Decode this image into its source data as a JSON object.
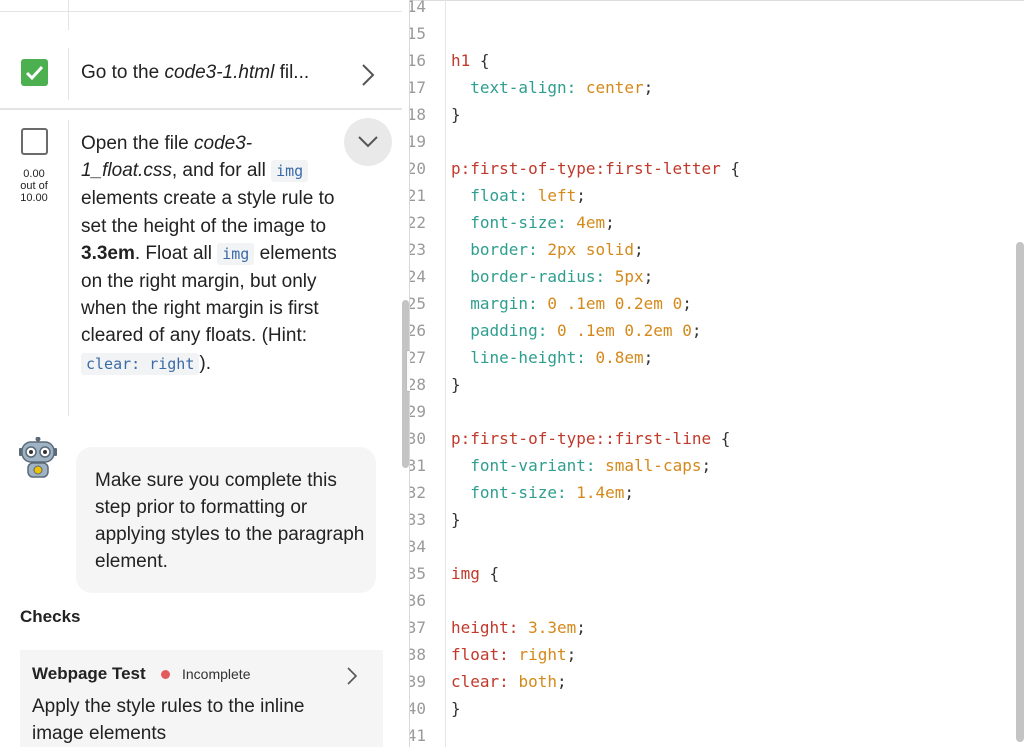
{
  "task1": {
    "status": "complete",
    "text_prefix": "Go to the ",
    "text_file": "code3-1.html",
    "text_suffix": " fil..."
  },
  "task2": {
    "status": "incomplete",
    "score": {
      "value": "0.00",
      "out_of_label": "out of",
      "total": "10.00"
    },
    "t1": "Open the file ",
    "t2": "code3-1_float.css",
    "t3": ", and for all ",
    "code1": "img",
    "t4": " elements create a style rule to set the height of the image to ",
    "t5": "3.3em",
    "t6": ". Float all ",
    "code2": "img",
    "t7": " elements on the right margin, but only when the right margin is first cleared of any floats. (Hint: ",
    "code3": "clear: right",
    "t8": ")."
  },
  "hint": {
    "avatar": "robot-icon",
    "text": "Make sure you complete this step prior to formatting or applying styles to the paragraph element."
  },
  "checks": {
    "title": "Checks",
    "items": [
      {
        "title": "Webpage Test",
        "status": "Incomplete",
        "status_color": "#e45a5a",
        "description": "Apply the style rules to the inline image elements"
      }
    ]
  },
  "editor": {
    "lines": [
      {
        "n": "14",
        "tokens": []
      },
      {
        "n": "15",
        "tokens": []
      },
      {
        "n": "16",
        "tokens": [
          {
            "t": "sel",
            "s": "h1"
          },
          {
            "t": "pun",
            "s": " {"
          }
        ]
      },
      {
        "n": "17",
        "tokens": [
          {
            "t": "pun",
            "s": "  "
          },
          {
            "t": "prop",
            "s": "text-align:"
          },
          {
            "t": "pun",
            "s": " "
          },
          {
            "t": "val",
            "s": "center"
          },
          {
            "t": "pun",
            "s": ";"
          }
        ]
      },
      {
        "n": "18",
        "tokens": [
          {
            "t": "pun",
            "s": "}"
          }
        ]
      },
      {
        "n": "19",
        "tokens": []
      },
      {
        "n": "20",
        "tokens": [
          {
            "t": "sel",
            "s": "p:first-of-type:first-letter"
          },
          {
            "t": "pun",
            "s": " {"
          }
        ]
      },
      {
        "n": "21",
        "tokens": [
          {
            "t": "pun",
            "s": "  "
          },
          {
            "t": "prop",
            "s": "float:"
          },
          {
            "t": "pun",
            "s": " "
          },
          {
            "t": "val",
            "s": "left"
          },
          {
            "t": "pun",
            "s": ";"
          }
        ]
      },
      {
        "n": "22",
        "tokens": [
          {
            "t": "pun",
            "s": "  "
          },
          {
            "t": "prop",
            "s": "font-size:"
          },
          {
            "t": "pun",
            "s": " "
          },
          {
            "t": "val",
            "s": "4em"
          },
          {
            "t": "pun",
            "s": ";"
          }
        ]
      },
      {
        "n": "23",
        "tokens": [
          {
            "t": "pun",
            "s": "  "
          },
          {
            "t": "prop",
            "s": "border:"
          },
          {
            "t": "pun",
            "s": " "
          },
          {
            "t": "val",
            "s": "2px solid"
          },
          {
            "t": "pun",
            "s": ";"
          }
        ]
      },
      {
        "n": "24",
        "tokens": [
          {
            "t": "pun",
            "s": "  "
          },
          {
            "t": "prop",
            "s": "border-radius:"
          },
          {
            "t": "pun",
            "s": " "
          },
          {
            "t": "val",
            "s": "5px"
          },
          {
            "t": "pun",
            "s": ";"
          }
        ]
      },
      {
        "n": "25",
        "tokens": [
          {
            "t": "pun",
            "s": "  "
          },
          {
            "t": "prop",
            "s": "margin:"
          },
          {
            "t": "pun",
            "s": " "
          },
          {
            "t": "val",
            "s": "0 .1em 0.2em 0"
          },
          {
            "t": "pun",
            "s": ";"
          }
        ]
      },
      {
        "n": "26",
        "tokens": [
          {
            "t": "pun",
            "s": "  "
          },
          {
            "t": "prop",
            "s": "padding:"
          },
          {
            "t": "pun",
            "s": " "
          },
          {
            "t": "val",
            "s": "0 .1em 0.2em 0"
          },
          {
            "t": "pun",
            "s": ";"
          }
        ]
      },
      {
        "n": "27",
        "tokens": [
          {
            "t": "pun",
            "s": "  "
          },
          {
            "t": "prop",
            "s": "line-height:"
          },
          {
            "t": "pun",
            "s": " "
          },
          {
            "t": "val",
            "s": "0.8em"
          },
          {
            "t": "pun",
            "s": ";"
          }
        ]
      },
      {
        "n": "28",
        "tokens": [
          {
            "t": "pun",
            "s": "}"
          }
        ]
      },
      {
        "n": "29",
        "tokens": []
      },
      {
        "n": "30",
        "tokens": [
          {
            "t": "sel",
            "s": "p:first-of-type::first-line"
          },
          {
            "t": "pun",
            "s": " {"
          }
        ]
      },
      {
        "n": "31",
        "tokens": [
          {
            "t": "pun",
            "s": "  "
          },
          {
            "t": "prop",
            "s": "font-variant:"
          },
          {
            "t": "pun",
            "s": " "
          },
          {
            "t": "val",
            "s": "small-caps"
          },
          {
            "t": "pun",
            "s": ";"
          }
        ]
      },
      {
        "n": "32",
        "tokens": [
          {
            "t": "pun",
            "s": "  "
          },
          {
            "t": "prop",
            "s": "font-size:"
          },
          {
            "t": "pun",
            "s": " "
          },
          {
            "t": "val",
            "s": "1.4em"
          },
          {
            "t": "pun",
            "s": ";"
          }
        ]
      },
      {
        "n": "33",
        "tokens": [
          {
            "t": "pun",
            "s": "}"
          }
        ]
      },
      {
        "n": "34",
        "tokens": []
      },
      {
        "n": "35",
        "tokens": [
          {
            "t": "sel",
            "s": "img"
          },
          {
            "t": "pun",
            "s": " {"
          }
        ]
      },
      {
        "n": "36",
        "tokens": []
      },
      {
        "n": "37",
        "tokens": [
          {
            "t": "sel",
            "s": "height:"
          },
          {
            "t": "pun",
            "s": " "
          },
          {
            "t": "val",
            "s": "3.3em"
          },
          {
            "t": "pun",
            "s": ";"
          }
        ]
      },
      {
        "n": "38",
        "tokens": [
          {
            "t": "sel",
            "s": "float:"
          },
          {
            "t": "pun",
            "s": " "
          },
          {
            "t": "val",
            "s": "right"
          },
          {
            "t": "pun",
            "s": ";"
          }
        ]
      },
      {
        "n": "39",
        "tokens": [
          {
            "t": "sel",
            "s": "clear:"
          },
          {
            "t": "pun",
            "s": " "
          },
          {
            "t": "val",
            "s": "both"
          },
          {
            "t": "pun",
            "s": ";"
          }
        ]
      },
      {
        "n": "40",
        "tokens": [
          {
            "t": "pun",
            "s": "}"
          }
        ]
      },
      {
        "n": "41",
        "tokens": []
      }
    ]
  }
}
